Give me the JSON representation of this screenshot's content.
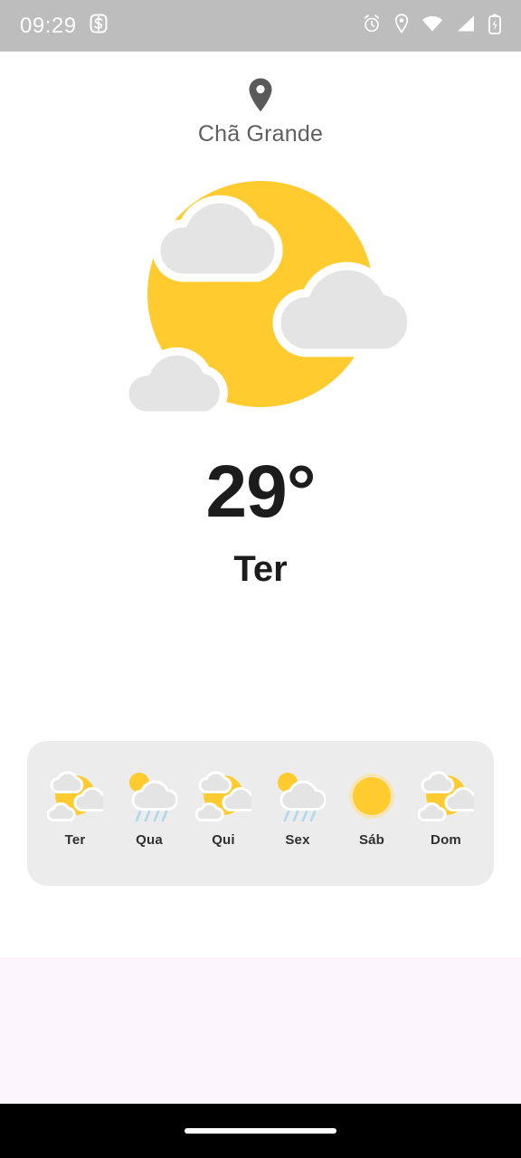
{
  "status_bar": {
    "time": "09:29",
    "left_icons": [
      "s-badge-icon"
    ],
    "right_icons": [
      "alarm-icon",
      "location-pin-icon",
      "wifi-icon",
      "cell-signal-icon",
      "battery-charging-icon"
    ],
    "background_color": "#BDBDBD",
    "foreground_color": "#FFFFFF"
  },
  "location": {
    "icon": "map-pin-icon",
    "name": "Chã Grande"
  },
  "current": {
    "icon": "sun-behind-clouds-icon",
    "temperature": "29°",
    "day": "Ter"
  },
  "forecast": {
    "days": [
      {
        "label": "Ter",
        "icon": "sun-behind-clouds-icon"
      },
      {
        "label": "Qua",
        "icon": "sun-behind-rain-cloud-icon"
      },
      {
        "label": "Qui",
        "icon": "sun-behind-clouds-icon"
      },
      {
        "label": "Sex",
        "icon": "sun-behind-rain-cloud-icon"
      },
      {
        "label": "Sáb",
        "icon": "sun-icon"
      },
      {
        "label": "Dom",
        "icon": "sun-behind-clouds-icon"
      }
    ]
  },
  "colors": {
    "sun_yellow": "#FFCB2E",
    "cloud_gray": "#E4E4E4",
    "card_background": "#ECECEC",
    "panel_lavender": "#FDF5FE",
    "text_dark": "#1C1C1C",
    "text_muted": "#5F5F5F",
    "rain_blue": "#AFD9EE"
  },
  "nav_bar": {
    "home_indicator": "home-indicator"
  }
}
